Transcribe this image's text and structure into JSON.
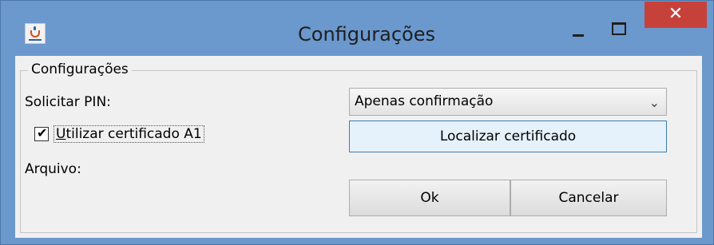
{
  "window": {
    "title": "Configurações",
    "close_glyph": "✕",
    "icon": "java-cup-icon"
  },
  "group": {
    "title": "Configurações"
  },
  "form": {
    "pin_label": "Solicitar PIN:",
    "pin_selected": "Apenas confirmação",
    "use_a1_checked": true,
    "use_a1_label_first": "U",
    "use_a1_label_rest": "tilizar certificado A1",
    "file_label": "Arquivo:",
    "locate_button": "Localizar certificado"
  },
  "actions": {
    "ok": "Ok",
    "cancel": "Cancelar"
  }
}
